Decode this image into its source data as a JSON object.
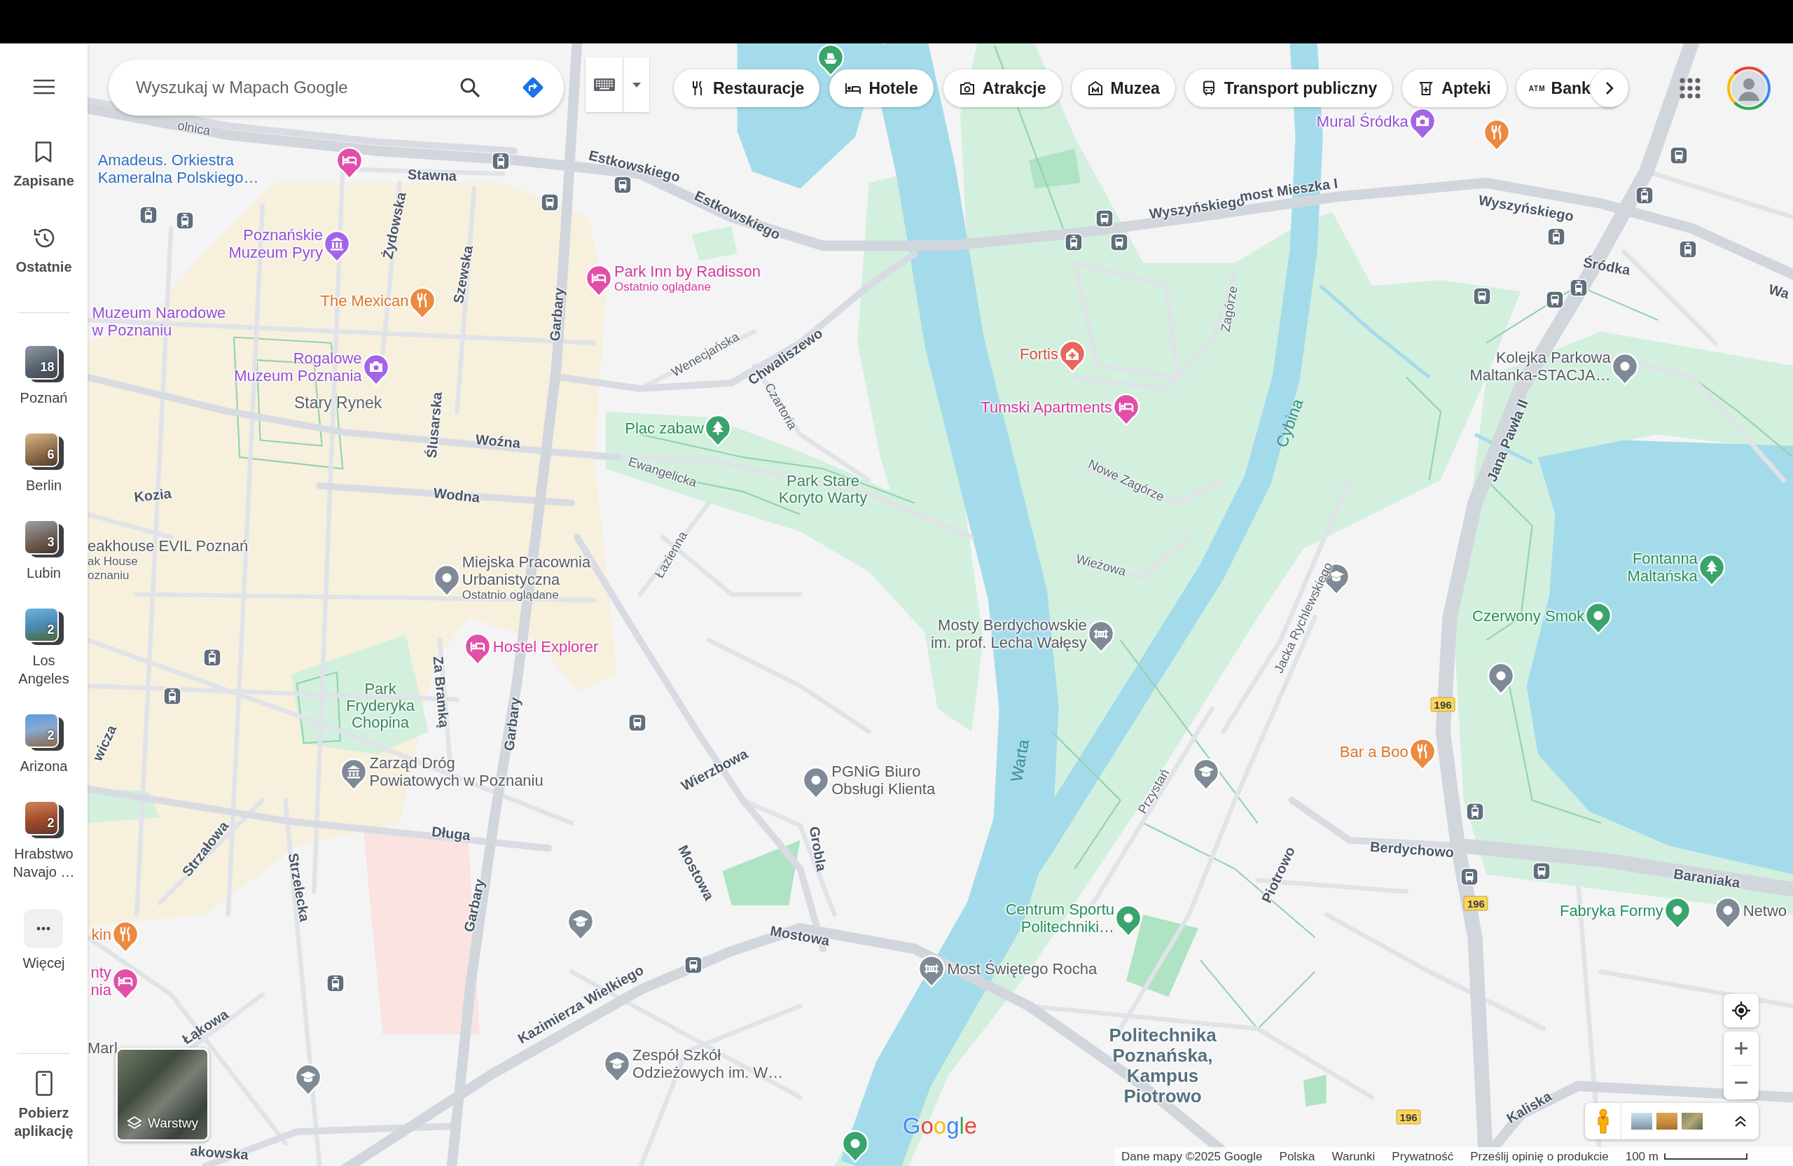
{
  "sidebar": {
    "nav": [
      {
        "label": "Zapisane",
        "kind": "saved"
      },
      {
        "label": "Ostatnie",
        "kind": "history"
      }
    ],
    "recent_places": [
      {
        "label": "Poznań",
        "count": "18"
      },
      {
        "label": "Berlin",
        "count": "6"
      },
      {
        "label": "Lubin",
        "count": "3"
      },
      {
        "label": "Los Angeles",
        "count": "2"
      },
      {
        "label": "Arizona",
        "count": "2"
      },
      {
        "label": "Hrabstwo Navajo …",
        "count": "2"
      }
    ],
    "more": {
      "label": "Więcej"
    },
    "get_app": {
      "label": "Pobierz aplikację"
    }
  },
  "search": {
    "placeholder": "Wyszukaj w Mapach Google"
  },
  "categories": [
    {
      "label": "Restauracje",
      "kind": "restaurant"
    },
    {
      "label": "Hotele",
      "kind": "hotel"
    },
    {
      "label": "Atrakcje",
      "kind": "attraction"
    },
    {
      "label": "Muzea",
      "kind": "museum"
    },
    {
      "label": "Transport publiczny",
      "kind": "transit"
    },
    {
      "label": "Apteki",
      "kind": "pharmacy"
    },
    {
      "label": "Bank",
      "kind": "atm",
      "icon_text": "ATM"
    }
  ],
  "map": {
    "places": [
      {
        "name": "Mural Śródka",
        "kind": "attraction"
      },
      {
        "name": "Amadeus. Orkiestra\nKameralna Polskiego…",
        "kind": "music"
      },
      {
        "name": "Poznańskie\nMuzeum Pyry",
        "kind": "museum"
      },
      {
        "name": "Park Inn by Radisson",
        "note": "Ostatnio oglądane",
        "kind": "hotel"
      },
      {
        "name": "The Mexican",
        "kind": "restaurant"
      },
      {
        "name": "Muzeum Narodowe\nw Poznaniu",
        "kind": "museum"
      },
      {
        "name": "Rogalowe\nMuzeum Poznania",
        "kind": "attraction"
      },
      {
        "name": "Fortis",
        "kind": "health"
      },
      {
        "name": "Kolejka Parkowa\nMaltanka-STACJA…",
        "kind": "generic"
      },
      {
        "name": "Tumski Apartments",
        "kind": "hotel"
      },
      {
        "name": "Plac zabaw",
        "kind": "park"
      },
      {
        "name": "eakhouse EVIL Poznań",
        "note": "ak House\noznaniu",
        "kind": "generic"
      },
      {
        "name": "Miejska Pracownia\nUrbanistyczna",
        "note": "Ostatnio oglądane",
        "kind": "generic"
      },
      {
        "name": "Fontanna Maltańska",
        "kind": "park"
      },
      {
        "name": "Hostel Explorer",
        "kind": "hotel"
      },
      {
        "name": "Mosty Berdychowskie\nim. prof. Lecha Wałęsy",
        "kind": "bridge"
      },
      {
        "name": "Czerwony Smok",
        "kind": "leisure"
      },
      {
        "name": "Zarząd Dróg\nPowiatowych w Poznaniu",
        "kind": "office"
      },
      {
        "name": "PGNiG Biuro\nObsługi Klienta",
        "kind": "generic"
      },
      {
        "name": "Bar a Boo",
        "kind": "restaurant"
      },
      {
        "name": "kin",
        "kind": "restaurant"
      },
      {
        "name": "Centrum Sportu\nPolitechniki…",
        "kind": "leisure"
      },
      {
        "name": "Fabryka Formy",
        "kind": "leisure"
      },
      {
        "name": "Netwo",
        "kind": "generic"
      },
      {
        "name": "nty\nnia",
        "kind": "hotel"
      },
      {
        "name": "Most Świętego Rocha",
        "kind": "bridge"
      },
      {
        "name": "Marl",
        "kind": "generic"
      },
      {
        "name": "Zespół Szkół\nOdzieżowych im. W…",
        "kind": "school"
      }
    ],
    "areas": [
      {
        "name": "Stary Rynek",
        "kind": "district"
      },
      {
        "name": "Park Stare\nKoryto Warty",
        "kind": "park"
      },
      {
        "name": "Park\nFryderyka\nChopina",
        "kind": "park"
      },
      {
        "name": "Politechnika\nPoznańska,\nKampus\nPiotrowo",
        "kind": "campus"
      }
    ],
    "streets": [
      {
        "name": "olnica",
        "kind": "minor"
      },
      {
        "name": "Estkowskiego",
        "kind": "major"
      },
      {
        "name": "Estkowskiego",
        "kind": "major"
      },
      {
        "name": "Stawna",
        "kind": "major"
      },
      {
        "name": "Żydowska",
        "kind": "major"
      },
      {
        "name": "Szewska",
        "kind": "major"
      },
      {
        "name": "Garbary",
        "kind": "major"
      },
      {
        "name": "Wenecjańska",
        "kind": "minor"
      },
      {
        "name": "Chwaliszewo",
        "kind": "major"
      },
      {
        "name": "Czartoria",
        "kind": "minor"
      },
      {
        "name": "Ślusarska",
        "kind": "major"
      },
      {
        "name": "Woźna",
        "kind": "major"
      },
      {
        "name": "Wodna",
        "kind": "major"
      },
      {
        "name": "Kozia",
        "kind": "major"
      },
      {
        "name": "Ewangelicka",
        "kind": "minor"
      },
      {
        "name": "Łazienna",
        "kind": "minor"
      },
      {
        "name": "Za Bramką",
        "kind": "major"
      },
      {
        "name": "Garbary",
        "kind": "major"
      },
      {
        "name": "Wierzbowa",
        "kind": "major"
      },
      {
        "name": "Grobla",
        "kind": "major"
      },
      {
        "name": "Mostowa",
        "kind": "major"
      },
      {
        "name": "Długa",
        "kind": "major"
      },
      {
        "name": "Strzałowa",
        "kind": "major"
      },
      {
        "name": "Strzelecka",
        "kind": "major"
      },
      {
        "name": "Garbary",
        "kind": "major"
      },
      {
        "name": "Mostowa",
        "kind": "major"
      },
      {
        "name": "Kazimierza Wielkiego",
        "kind": "major"
      },
      {
        "name": "Łąkowa",
        "kind": "major"
      },
      {
        "name": "wicza",
        "kind": "major"
      },
      {
        "name": "Wyszyńskiego",
        "kind": "major"
      },
      {
        "name": "most Mieszka I",
        "kind": "major"
      },
      {
        "name": "Wyszyńskiego",
        "kind": "major"
      },
      {
        "name": "Śródka",
        "kind": "major"
      },
      {
        "name": "Zagórze",
        "kind": "minor"
      },
      {
        "name": "Jana Pawła II",
        "kind": "major"
      },
      {
        "name": "Nowe Zagórze",
        "kind": "minor"
      },
      {
        "name": "Wieżowa",
        "kind": "minor"
      },
      {
        "name": "Jacka Rychlewskiego",
        "kind": "minor"
      },
      {
        "name": "Przystań",
        "kind": "minor"
      },
      {
        "name": "Piotrowo",
        "kind": "major"
      },
      {
        "name": "Berdychowo",
        "kind": "major"
      },
      {
        "name": "Baraniaka",
        "kind": "major"
      },
      {
        "name": "Kaliska",
        "kind": "major"
      },
      {
        "name": "Wa",
        "kind": "major"
      },
      {
        "name": "akowska",
        "kind": "major"
      }
    ],
    "water": [
      {
        "name": "Cybina"
      },
      {
        "name": "Warta"
      }
    ],
    "route_shields": [
      "196",
      "196",
      "196"
    ]
  },
  "layers": {
    "label": "Warstwy"
  },
  "logo": {
    "text": "Google"
  },
  "attribution": {
    "credit": "Dane mapy ©2025 Google",
    "links": [
      "Polska",
      "Warunki",
      "Prywatność",
      "Prześlij opinię o produkcie"
    ],
    "scale": "100 m"
  }
}
